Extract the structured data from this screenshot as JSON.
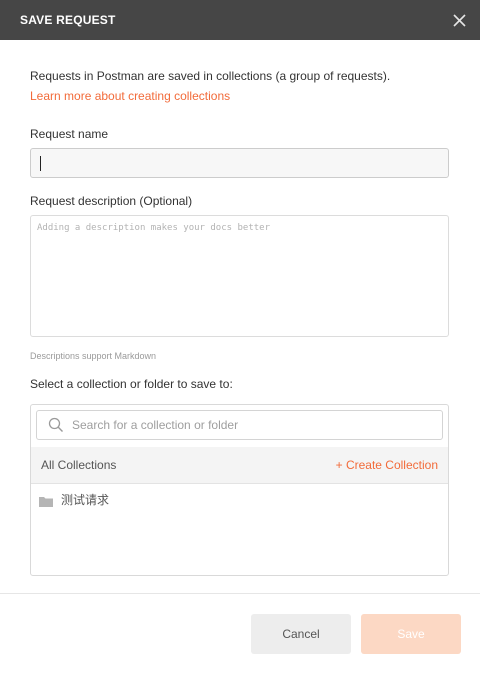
{
  "dialog": {
    "title": "SAVE REQUEST",
    "close_icon": "close-icon"
  },
  "intro": {
    "text": "Requests in Postman are saved in collections (a group of requests).",
    "link": "Learn more about creating collections"
  },
  "request_name": {
    "label": "Request name",
    "value": ""
  },
  "request_description": {
    "label": "Request description (Optional)",
    "placeholder": "Adding a description makes your docs better",
    "note": "Descriptions support Markdown"
  },
  "collection_picker": {
    "label": "Select a collection or folder to save to:",
    "search_placeholder": "Search for a collection or folder",
    "breadcrumb": "All Collections",
    "create_label": "+ Create Collection",
    "items": [
      {
        "name": "测试请求",
        "icon": "folder-icon"
      }
    ]
  },
  "footer": {
    "cancel_label": "Cancel",
    "save_label": "Save"
  },
  "colors": {
    "accent": "#f26b3a",
    "titlebar": "#464646",
    "save_disabled": "#fcd8c4"
  }
}
